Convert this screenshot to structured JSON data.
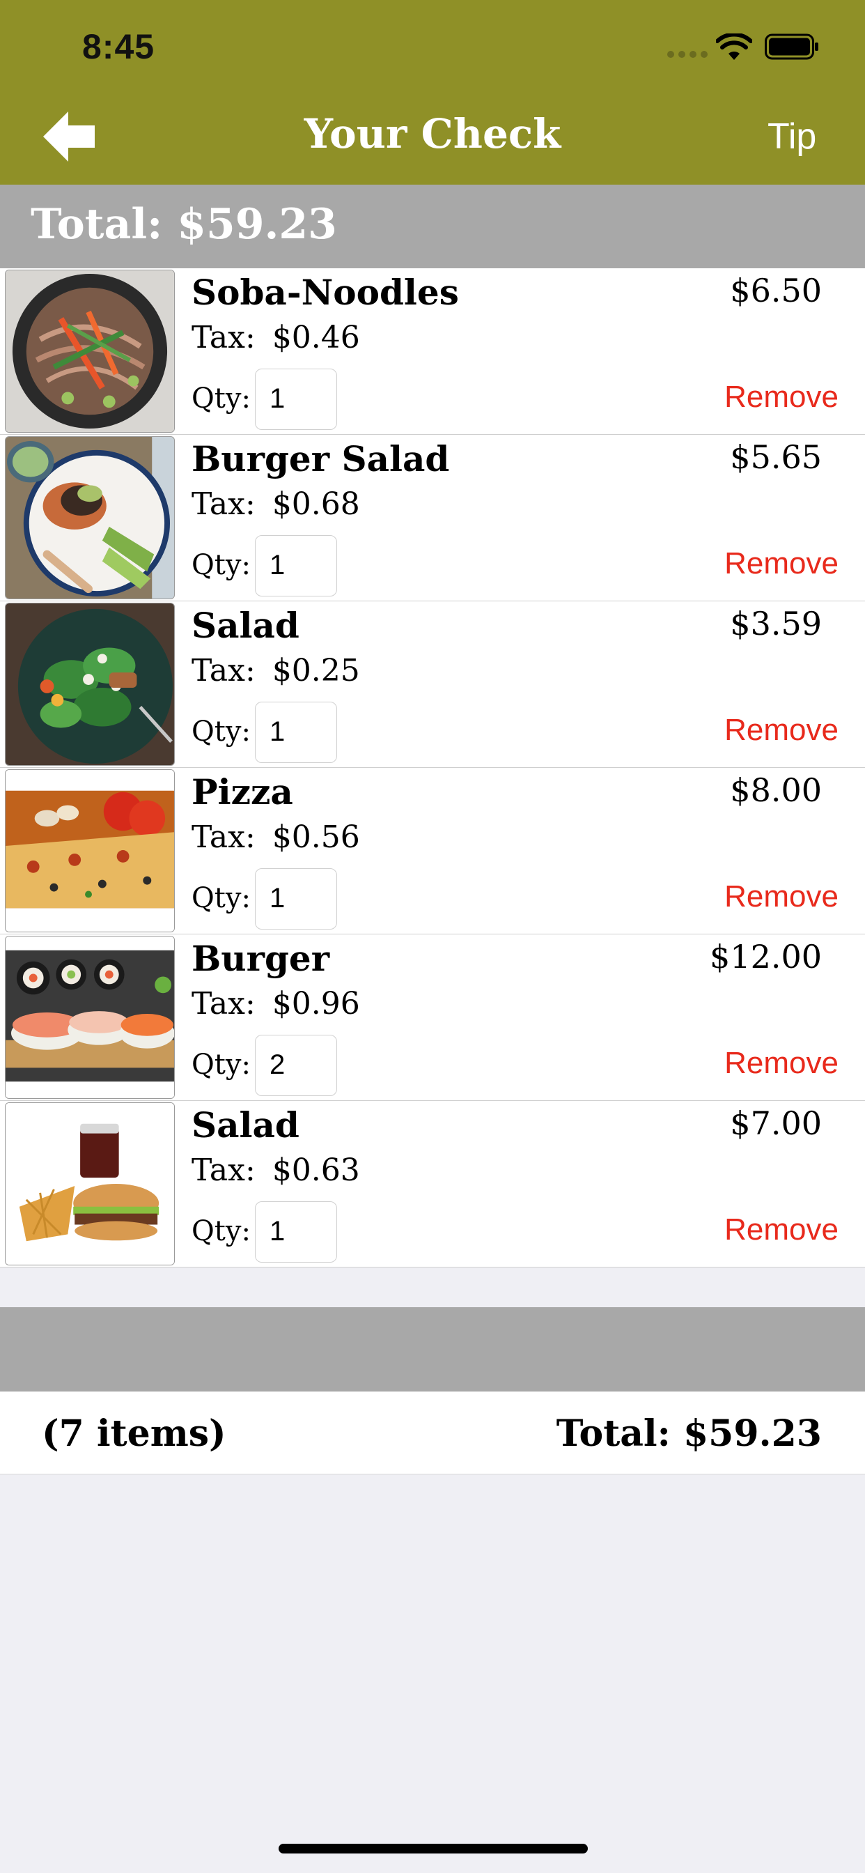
{
  "status_bar": {
    "time": "8:45"
  },
  "nav": {
    "title": "Your Check",
    "tip_label": "Tip",
    "back_icon": "back-arrow-icon"
  },
  "total_banner": "Total: $59.23",
  "items": [
    {
      "name": "Soba-Noodles",
      "price": "$6.50",
      "tax_label": "Tax:",
      "tax": "$0.46",
      "qty_label": "Qty:",
      "qty": "1",
      "remove_label": "Remove"
    },
    {
      "name": "Burger Salad",
      "price": "$5.65",
      "tax_label": "Tax:",
      "tax": "$0.68",
      "qty_label": "Qty:",
      "qty": "1",
      "remove_label": "Remove"
    },
    {
      "name": "Salad",
      "price": "$3.59",
      "tax_label": "Tax:",
      "tax": "$0.25",
      "qty_label": "Qty:",
      "qty": "1",
      "remove_label": "Remove"
    },
    {
      "name": "Pizza",
      "price": "$8.00",
      "tax_label": "Tax:",
      "tax": "$0.56",
      "qty_label": "Qty:",
      "qty": "1",
      "remove_label": "Remove"
    },
    {
      "name": "Burger",
      "price": "$12.00",
      "tax_label": "Tax:",
      "tax": "$0.96",
      "qty_label": "Qty:",
      "qty": "2",
      "remove_label": "Remove"
    },
    {
      "name": "Salad",
      "price": "$7.00",
      "tax_label": "Tax:",
      "tax": "$0.63",
      "qty_label": "Qty:",
      "qty": "1",
      "remove_label": "Remove"
    }
  ],
  "footer": {
    "item_count": "(7 items)",
    "total": "Total: $59.23"
  },
  "colors": {
    "nav_bar": "#8f9027",
    "banner": "#a8a8a8",
    "remove": "#e82a1c",
    "background": "#efeff4"
  }
}
